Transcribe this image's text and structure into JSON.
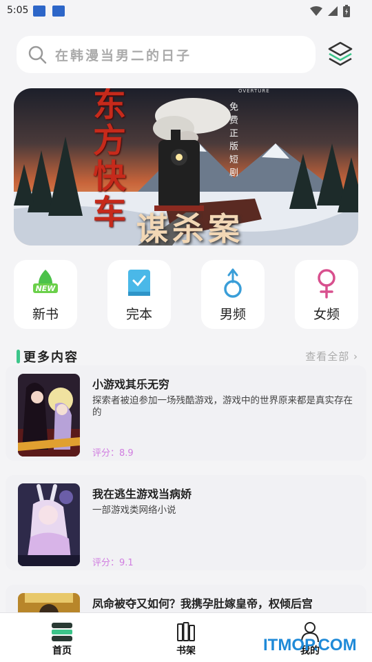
{
  "status_bar": {
    "time": "5:05"
  },
  "search": {
    "placeholder": "在韩漫当男二的日子"
  },
  "banner": {
    "title": "东方快车",
    "subtitle": "谋杀案",
    "side_text": "免费正版短剧",
    "overture": "OVERTURE"
  },
  "categories": [
    {
      "label": "新书",
      "icon": "new-book-icon"
    },
    {
      "label": "完本",
      "icon": "completed-book-icon"
    },
    {
      "label": "男频",
      "icon": "male-icon"
    },
    {
      "label": "女频",
      "icon": "female-icon"
    }
  ],
  "section": {
    "title": "更多内容",
    "more": "查看全部"
  },
  "books": [
    {
      "title": "小游戏其乐无穷",
      "desc": "探索者被迫参加一场残酷游戏，游戏中的世界原来都是真实存在的",
      "score": "评分：8.9"
    },
    {
      "title": "我在逃生游戏当病娇",
      "desc": "一部游戏类网络小说",
      "score": "评分：9.1"
    },
    {
      "title": "凤命被夺又如何？我携孕肚嫁皇帝，权倾后宫",
      "desc": "",
      "score": ""
    }
  ],
  "bottom_nav": [
    {
      "label": "首页",
      "icon": "home-icon"
    },
    {
      "label": "书架",
      "icon": "bookshelf-icon"
    },
    {
      "label": "我的",
      "icon": "profile-icon"
    }
  ],
  "watermark": "ITMOP.COM",
  "colors": {
    "accent": "#3cc58a",
    "score": "#d07de0",
    "background": "#f4f4f6"
  }
}
